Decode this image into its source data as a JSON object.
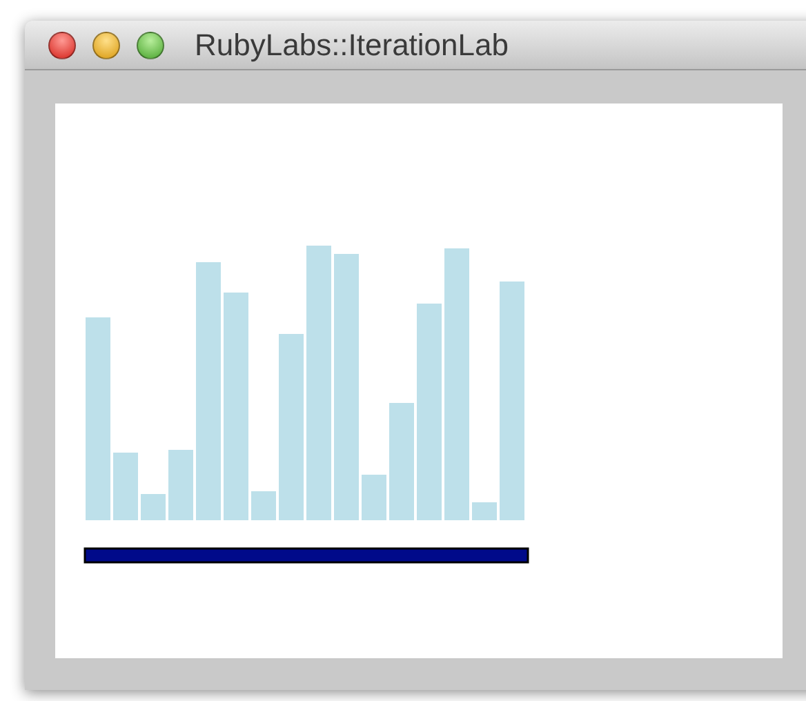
{
  "window": {
    "title": "RubyLabs::IterationLab"
  }
}
